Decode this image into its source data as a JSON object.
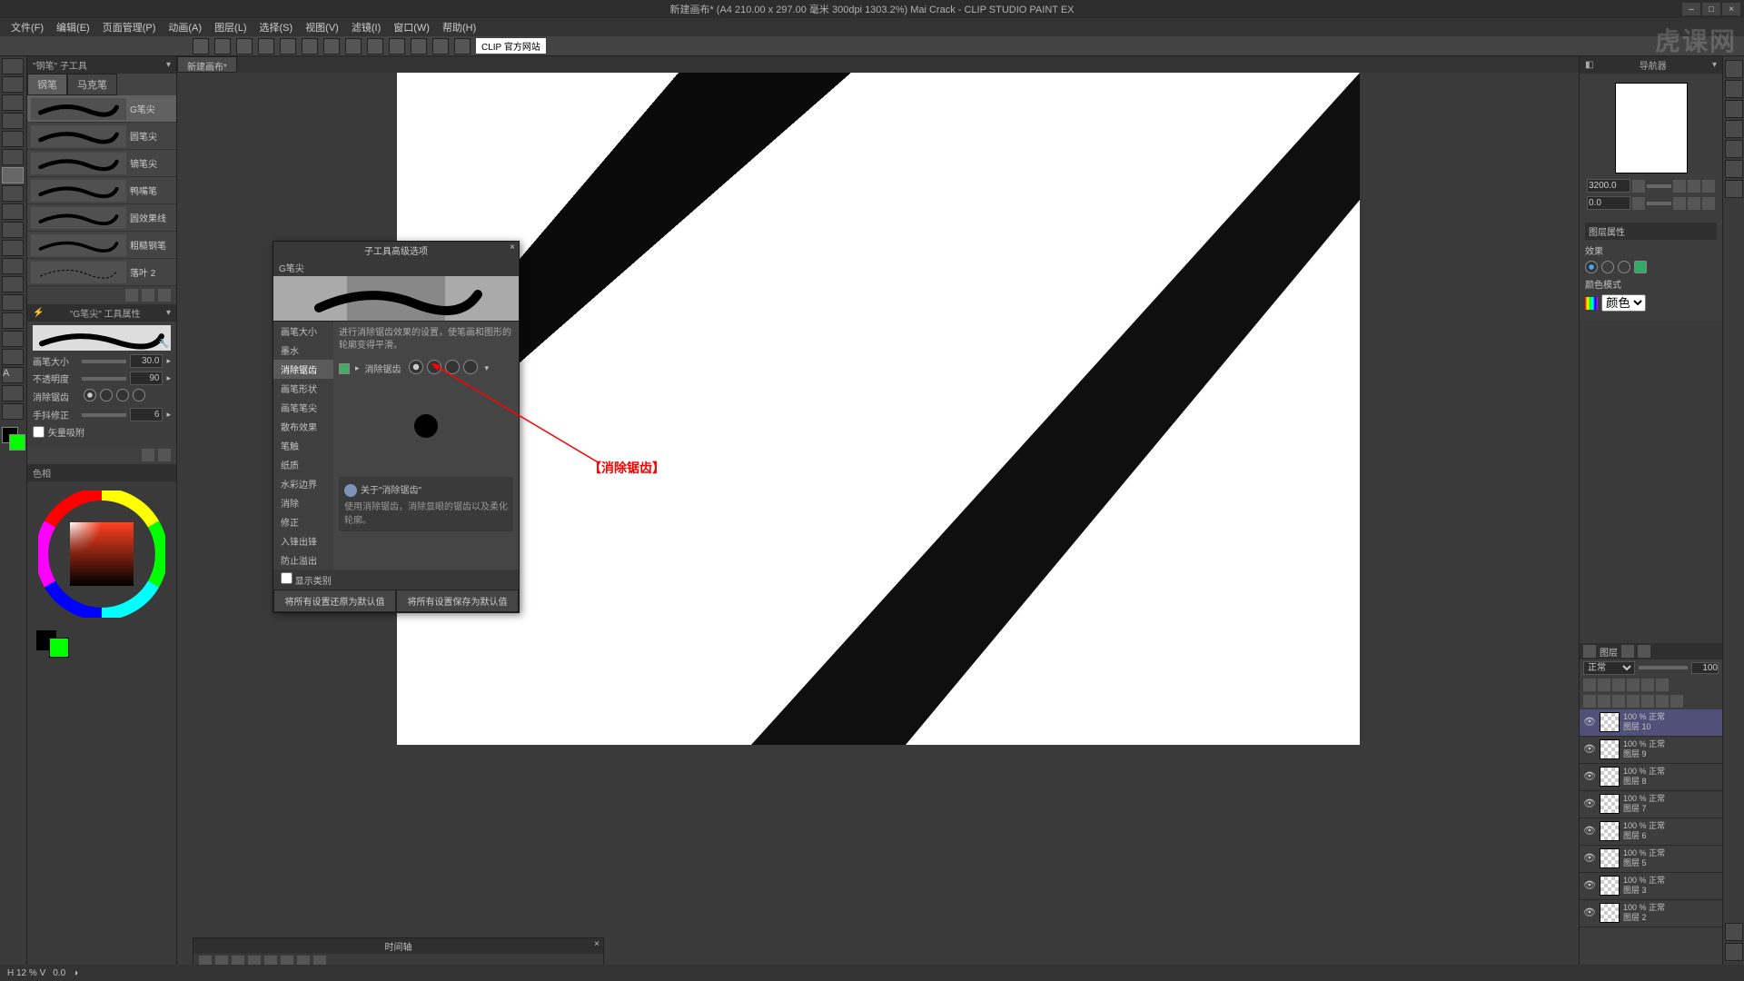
{
  "title": "新建画布* (A4 210.00 x 297.00 毫米 300dpi 1303.2%)   Mai Crack - CLIP STUDIO PAINT EX",
  "watermark": "虎课网",
  "menu": [
    "文件(F)",
    "编辑(E)",
    "页面管理(P)",
    "动画(A)",
    "图层(L)",
    "选择(S)",
    "视图(V)",
    "滤镜(I)",
    "窗口(W)",
    "帮助(H)"
  ],
  "clipbtn": "CLIP 官方网站",
  "subtool_title": "\"钢笔\" 子工具",
  "tool_tabs": {
    "active": "钢笔",
    "other": "马克笔"
  },
  "brushes": [
    "G笔尖",
    "圆笔尖",
    "镝笔尖",
    "鸭嘴笔",
    "圆效果线",
    "粗糙钢笔",
    "落叶 2"
  ],
  "brush_prop_title": "\"G笔尖\" 工具属性",
  "props": {
    "size_label": "画笔大小",
    "size_val": "30.0",
    "opacity_label": "不透明度",
    "opacity_val": "90",
    "aa_label": "消除锯齿",
    "stab_label": "手抖修正",
    "stab_val": "6",
    "vec_label": "矢量吸附"
  },
  "canvas_tab": "新建画布*",
  "dialog": {
    "title": "子工具高级选项",
    "sub": "G笔尖",
    "side": [
      "画笔大小",
      "墨水",
      "消除锯齿",
      "画笔形状",
      "画笔笔尖",
      "散布效果",
      "笔触",
      "纸质",
      "水彩边界",
      "消除",
      "修正",
      "入锋出锋",
      "防止溢出"
    ],
    "side_sel": 2,
    "desc": "进行消除锯齿效果的设置，使笔画和图形的轮廓变得平滑。",
    "aa_label": "消除锯齿",
    "hint_title": "关于\"消除锯齿\"",
    "hint_body": "使用消除锯齿，消除显眼的锯齿以及柔化轮廓。",
    "show_cat": "显示类别",
    "reset": "将所有设置还原为默认值",
    "save": "将所有设置保存为默认值"
  },
  "annotation": "【消除锯齿】",
  "nav": {
    "title": "导航器",
    "zoom": "3200.0",
    "rot": "0.0"
  },
  "layer_prop": {
    "title": "图层属性",
    "effect": "效果",
    "blend_label": "颜色模式",
    "blend": "颜色"
  },
  "layers": {
    "panel_title": "图层",
    "blend": "正常",
    "opacity": "100",
    "items": [
      {
        "name": "图层 10",
        "op": "100 % 正常",
        "sel": true
      },
      {
        "name": "图层 9",
        "op": "100 % 正常"
      },
      {
        "name": "图层 8",
        "op": "100 % 正常"
      },
      {
        "name": "图层 7",
        "op": "100 % 正常"
      },
      {
        "name": "图层 6",
        "op": "100 % 正常"
      },
      {
        "name": "图层 5",
        "op": "100 % 正常"
      },
      {
        "name": "图层 3",
        "op": "100 % 正常"
      },
      {
        "name": "图层 2",
        "op": "100 % 正常"
      }
    ]
  },
  "timeline": {
    "title": "时间轴"
  },
  "status": {
    "zoom": "H 12 % V",
    "rot": "0.0"
  }
}
